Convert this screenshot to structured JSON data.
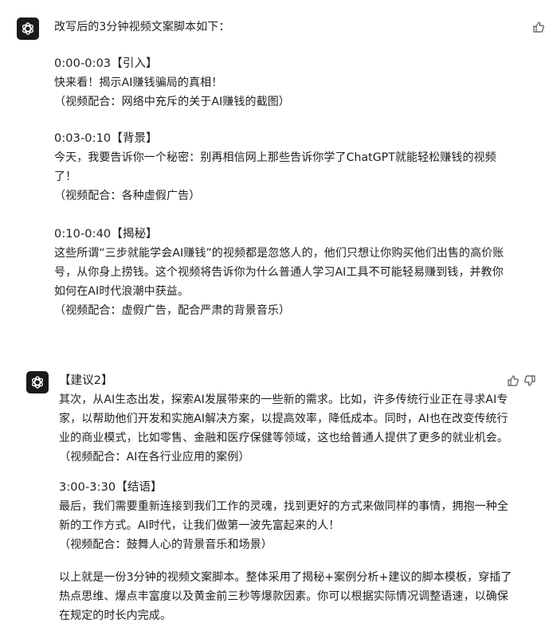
{
  "message1": {
    "intro": "改写后的3分钟视频文案脚本如下：",
    "sections": [
      {
        "heading": "0:00-0:03【引入】",
        "lines": [
          "快来看！揭示AI赚钱骗局的真相！"
        ],
        "note": "（视频配合：网络中充斥的关于AI赚钱的截图）"
      },
      {
        "heading": "0:03-0:10【背景】",
        "lines": [
          "今天，我要告诉你一个秘密：别再相信网上那些告诉你学了ChatGPT就能轻松赚钱的视频",
          "了！"
        ],
        "note": "（视频配合：各种虚假广告）"
      },
      {
        "heading": "0:10-0:40【揭秘】",
        "lines": [
          "这些所谓“三步就能学会AI赚钱”的视频都是忽悠人的，他们只想让你购买他们出售的高价账",
          "号，从你身上捞钱。这个视频将告诉你为什么普通人学习AI工具不可能轻易赚到钱，并教你",
          "如何在AI时代浪潮中获益。"
        ],
        "note": "（视频配合：虚假广告，配合严肃的背景音乐）"
      }
    ]
  },
  "message2": {
    "sections": [
      {
        "heading": "【建议2】",
        "lines": [
          "其次，从AI生态出发，探索AI发展带来的一些新的需求。比如，许多传统行业正在寻求AI专",
          "家，以帮助他们开发和实施AI解决方案，以提高效率，降低成本。同时，AI也在改变传统行",
          "业的商业模式，比如零售、金融和医疗保健等领域，这也给普通人提供了更多的就业机会。"
        ],
        "note": "（视频配合：AI在各行业应用的案例）"
      },
      {
        "heading": "3:00-3:30【结语】",
        "lines": [
          "最后，我们需要重新连接到我们工作的灵魂，找到更好的方式来做同样的事情，拥抱一种全",
          "新的工作方式。AI时代，让我们做第一波先富起来的人！"
        ],
        "note": "（视频配合：鼓舞人心的背景音乐和场景）"
      },
      {
        "heading": "",
        "lines": [
          "以上就是一份3分钟的视频文案脚本。整体采用了揭秘+案例分析+建议的脚本模板，穿插了",
          "热点思维、爆点丰富度以及黄金前三秒等爆款因素。你可以根据实际情况调整语速，以确保",
          "在规定的时长内完成。"
        ],
        "note": ""
      }
    ]
  },
  "icons": {
    "avatar": "openai-logo-icon",
    "like": "thumbs-up-icon",
    "dislike": "thumbs-down-icon"
  },
  "colors": {
    "avatar_bg": "#1a1a1a",
    "text": "#1f1f1f"
  }
}
